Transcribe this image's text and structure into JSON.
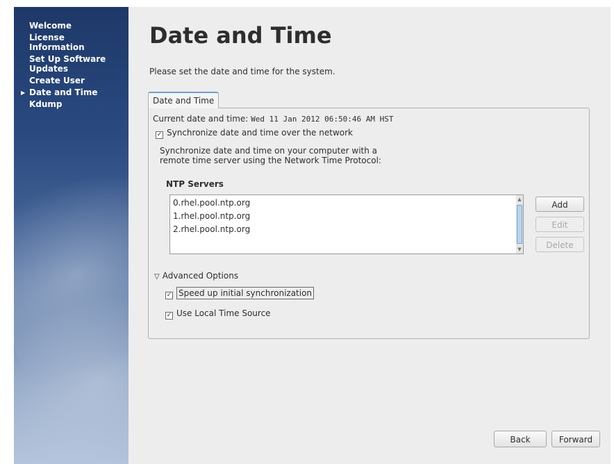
{
  "sidebar": {
    "items": [
      {
        "label": "Welcome",
        "current": false
      },
      {
        "label": "License Information",
        "current": false
      },
      {
        "label": "Set Up Software Updates",
        "current": false
      },
      {
        "label": "Create User",
        "current": false
      },
      {
        "label": "Date and Time",
        "current": true
      },
      {
        "label": "Kdump",
        "current": false
      }
    ],
    "current_marker_icon": "triangle-right-icon"
  },
  "main": {
    "title": "Date and Time",
    "subtitle": "Please set the date and time for the system.",
    "tab_label": "Date and Time",
    "current_label": "Current date and time:",
    "current_value": "Wed 11 Jan 2012 06:50:46 AM HST",
    "sync_label": "Synchronize date and time over the network",
    "sync_checked": true,
    "description_line1": "Synchronize date and time on your computer with a",
    "description_line2": "remote time server using the Network Time Protocol:",
    "ntp_heading": "NTP Servers",
    "ntp_servers": [
      "0.rhel.pool.ntp.org",
      "1.rhel.pool.ntp.org",
      "2.rhel.pool.ntp.org"
    ],
    "buttons": {
      "add": "Add",
      "edit": "Edit",
      "delete": "Delete"
    },
    "advanced_label": "Advanced Options",
    "advanced_expanded": true,
    "speed_label": "Speed up initial synchronization",
    "speed_checked": true,
    "local_label": "Use Local Time Source",
    "local_checked": true
  },
  "footer": {
    "back": "Back",
    "forward": "Forward"
  },
  "colors": {
    "sidebar_top": "#1e3868",
    "sidebar_bottom": "#b4c4dc",
    "tab_accent": "#6f9fd0",
    "panel_bg": "#ededed"
  }
}
